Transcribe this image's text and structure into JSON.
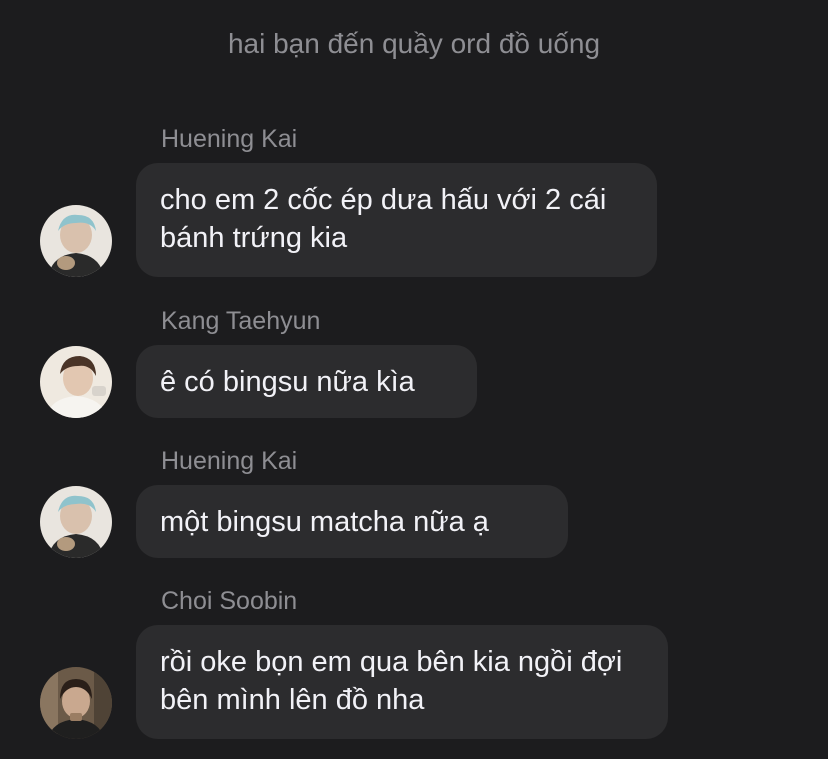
{
  "system_note": "hai bạn đến quầy ord đồ uống",
  "messages": [
    {
      "sender": "Huening Kai",
      "text": "cho em 2 cốc ép dưa hấu với 2 cái bánh trứng kia"
    },
    {
      "sender": "Kang Taehyun",
      "text": "ê có bingsu nữa kìa"
    },
    {
      "sender": "Huening Kai",
      "text": "một bingsu matcha nữa ạ"
    },
    {
      "sender": "Choi Soobin",
      "text": "rồi oke bọn em qua bên kia ngồi đợi bên mình lên đồ nha"
    }
  ],
  "colors": {
    "background": "#1c1c1e",
    "bubble": "#2c2c2e",
    "sender_text": "#8e8e93",
    "message_text": "#f2f2f7"
  },
  "icons": {
    "avatar_huening_kai": "avatar-photo",
    "avatar_kang_taehyun": "avatar-photo",
    "avatar_choi_soobin": "avatar-photo"
  }
}
